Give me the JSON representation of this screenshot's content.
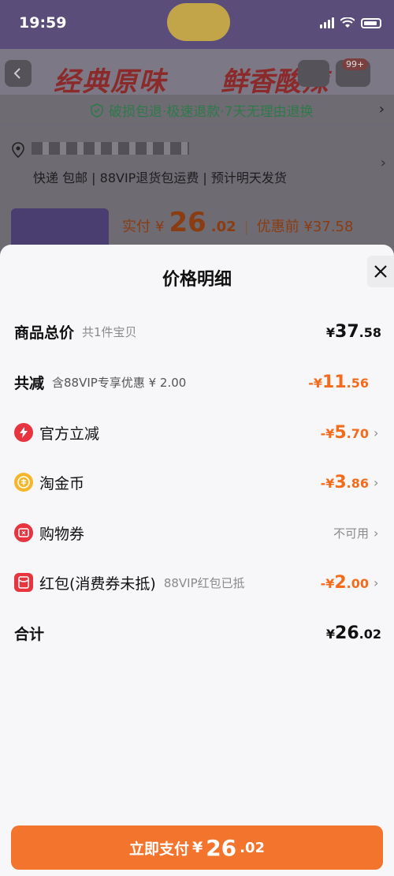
{
  "status_bar": {
    "time": "19:59"
  },
  "background": {
    "banner_text": "经典原味",
    "banner_text2": "鲜香酸辣",
    "cart_badge": "99+",
    "guarantee": "破损包退·极速退款·7天无理由退换",
    "delivery": "快递 包邮 | 88VIP退货包运费 | 预计明天发货",
    "paid_label": "实付",
    "paid_currency": "¥",
    "paid_int": "26",
    "paid_dec": ".02",
    "before_label": "优惠前 ¥37.58"
  },
  "sheet": {
    "title": "价格明细",
    "rows": {
      "total": {
        "title": "商品总价",
        "sub": "共1件宝贝",
        "cur": "¥",
        "int": "37",
        "dec": ".58"
      },
      "reduce": {
        "title": "共减",
        "sub": "含88VIP专享优惠 ¥ 2.00",
        "cur": "-¥",
        "int": "11",
        "dec": ".56"
      },
      "official": {
        "label": "官方立减",
        "cur": "-¥",
        "int": "5",
        "dec": ".70"
      },
      "coins": {
        "label": "淘金币",
        "cur": "-¥",
        "int": "3",
        "dec": ".86"
      },
      "voucher": {
        "label": "购物券",
        "status": "不可用"
      },
      "redpacket": {
        "label": "红包(消费券未抵)",
        "sub": "88VIP红包已抵",
        "cur": "-¥",
        "int": "2",
        "dec": ".00"
      },
      "sum": {
        "title": "合计",
        "cur": "¥",
        "int": "26",
        "dec": ".02"
      }
    },
    "pay_button": {
      "label": "立即支付",
      "cur": "¥",
      "int": "26",
      "dec": ".02"
    }
  },
  "colors": {
    "accent": "#f46b1c",
    "button": "#f2742d",
    "sheet_bg": "#f7f7f9"
  }
}
